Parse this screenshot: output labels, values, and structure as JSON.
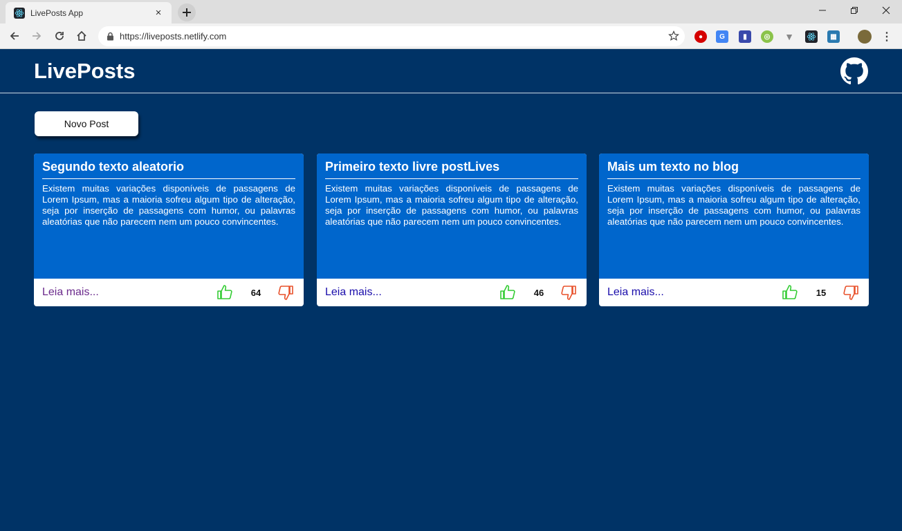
{
  "browser": {
    "tab_title": "LivePosts App",
    "tab_close": "×",
    "url": "https://liveposts.netlify.com"
  },
  "app": {
    "title": "LivePosts",
    "new_post_label": "Novo Post",
    "colors": {
      "background": "#003366",
      "card": "#0066cc",
      "like": "#33cc33",
      "dislike": "#e8502a"
    }
  },
  "posts": [
    {
      "title": "Segundo texto aleatorio",
      "text": "Existem muitas variações disponíveis de passagens de Lorem Ipsum, mas a maioria sofreu algum tipo de alteração, seja por inserção de passagens com humor, ou palavras aleatórias que não parecem nem um pouco convincentes.",
      "read_more": "Leia mais...",
      "votes": "64",
      "link_color": "#6b2a8c"
    },
    {
      "title": "Primeiro texto livre postLives",
      "text": "Existem muitas variações disponíveis de passagens de Lorem Ipsum, mas a maioria sofreu algum tipo de alteração, seja por inserção de passagens com humor, ou palavras aleatórias que não parecem nem um pouco convincentes.",
      "read_more": "Leia mais...",
      "votes": "46",
      "link_color": "#1a0dab"
    },
    {
      "title": "Mais um texto no blog",
      "text": "Existem muitas variações disponíveis de passagens de Lorem Ipsum, mas a maioria sofreu algum tipo de alteração, seja por inserção de passagens com humor, ou palavras aleatórias que não parecem nem um pouco convincentes.",
      "read_more": "Leia mais...",
      "votes": "15",
      "link_color": "#1a0dab"
    }
  ]
}
